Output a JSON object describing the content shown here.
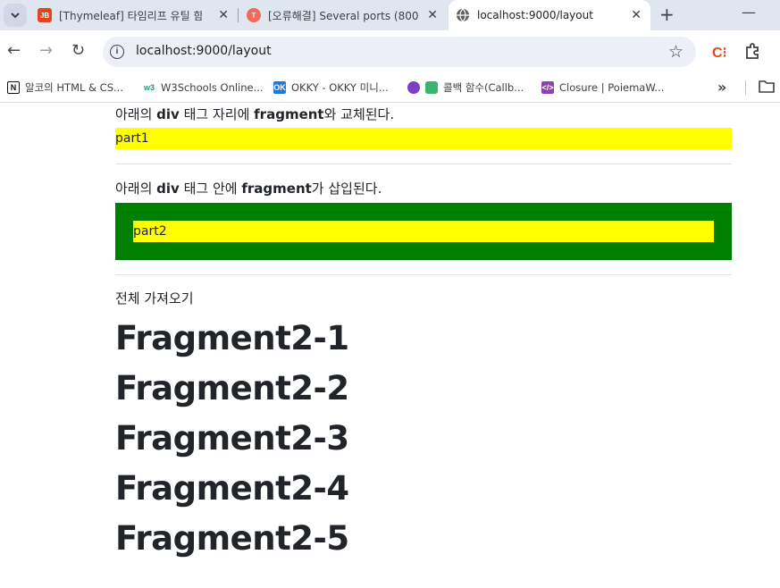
{
  "browser": {
    "tabs": [
      {
        "title": "[Thymeleaf] 타임리프 유틸 함",
        "favicon": "JB",
        "favicon_color": "#e2461e"
      },
      {
        "title": "[오류해결] Several ports (800",
        "favicon": "T",
        "favicon_color": "#ef6a5b"
      },
      {
        "title": "localhost:9000/layout",
        "favicon": "globe-icon"
      }
    ],
    "url": "localhost:9000/layout",
    "bookmarks": [
      {
        "label": "알코의 HTML & CS...",
        "icon": "N"
      },
      {
        "label": "W3Schools Online...",
        "icon": "w3"
      },
      {
        "label": "OKKY - OKKY 미니...",
        "icon": "OK"
      },
      {
        "label": "콜백 함수(Callb...",
        "icon": "mixed-icon"
      },
      {
        "label": "Closure | PoiemaW...",
        "icon": "</>"
      }
    ]
  },
  "content": {
    "caption1": {
      "prefix": "아래의 ",
      "b1": "div",
      "mid": " 태그 자리에 ",
      "b2": "fragment",
      "suffix": "와 교체된다."
    },
    "part1": "part1",
    "caption2": {
      "prefix": "아래의 ",
      "b1": "div",
      "mid": " 태그 안에 ",
      "b2": "fragment",
      "suffix": "가 삽입된다."
    },
    "part2": "part2",
    "caption3": "전체 가져오기",
    "fragments": [
      "Fragment2-1",
      "Fragment2-2",
      "Fragment2-3",
      "Fragment2-4",
      "Fragment2-5"
    ],
    "colors": {
      "yellow": "#ffff00",
      "green": "#008000"
    }
  }
}
